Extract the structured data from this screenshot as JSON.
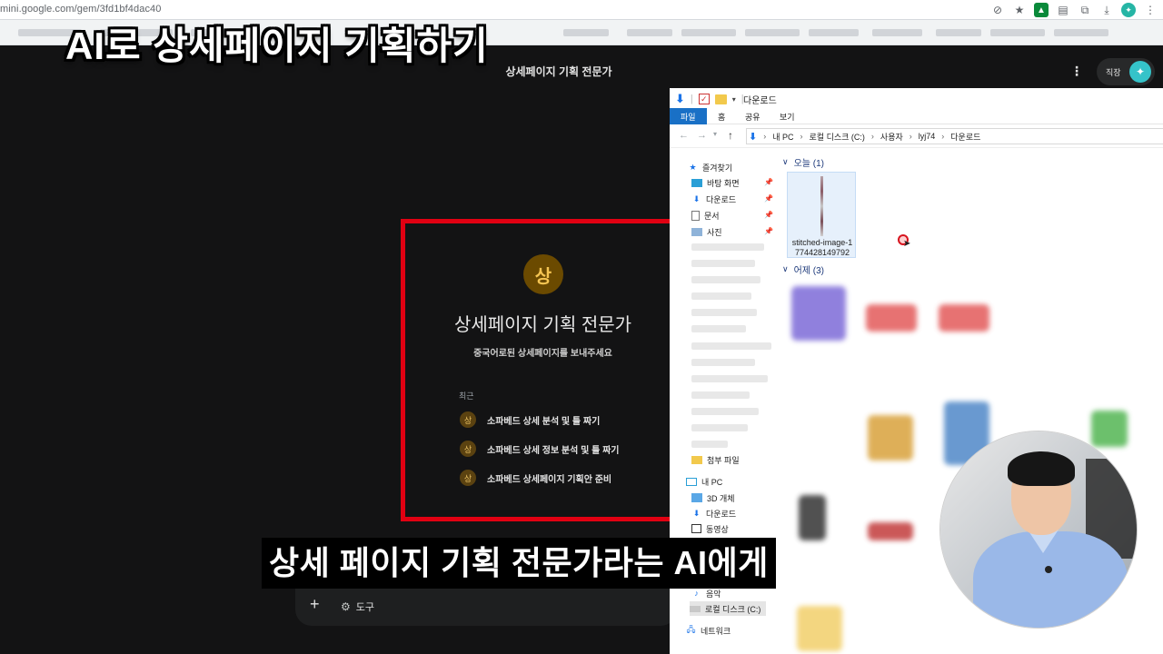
{
  "browser": {
    "url": "mini.google.com/gem/3fd1bf4dac40",
    "extension_icons": [
      "eye-off-icon",
      "star-icon",
      "extension-green-icon",
      "puzzle-icon",
      "download-icon",
      "profile-teal-icon"
    ]
  },
  "overlay": {
    "headline": "AI로 상세페이지 기획하기",
    "subtitle": "상세 페이지 기획 전문가라는 AI에게"
  },
  "gemini": {
    "page_title": "상세페이지 기획 전문가",
    "more_label": "⋮",
    "profile_label": "직장",
    "gem_avatar_letter": "상",
    "gem_name": "상세페이지 기획 전문가",
    "gem_description": "중국어로된 상세페이지를 보내주세요",
    "recent_label": "최근",
    "recent_items": [
      {
        "icon": "상",
        "label": "소파베드 상세 분석 및 틀 짜기"
      },
      {
        "icon": "상",
        "label": "소파베드 상세 정보 분석 및 틀 짜기"
      },
      {
        "icon": "상",
        "label": "소파베드 상세페이지 기획안 준비"
      }
    ],
    "input": {
      "plus": "+",
      "tools_label": "도구"
    },
    "accent_color": "#e10012"
  },
  "explorer": {
    "title": "다운로드",
    "ribbon_tabs": [
      "파일",
      "홈",
      "공유",
      "보기"
    ],
    "breadcrumb": [
      "내 PC",
      "로컬 디스크 (C:)",
      "사용자",
      "lyj74",
      "다운로드"
    ],
    "sidebar": {
      "quick_access": "즐겨찾기",
      "items": [
        "바탕 화면",
        "다운로드",
        "문서",
        "사진"
      ],
      "attach": "첨부 파일",
      "this_pc": "내 PC",
      "pc_items": [
        "3D 개체",
        "다운로드",
        "동영상"
      ],
      "music": "음악",
      "local_disk": "로컬 디스크 (C:)",
      "network": "네트워크"
    },
    "groups": {
      "today": "오늘 (1)",
      "yesterday": "어제 (3)"
    },
    "file": {
      "name_line1": "stitched-image-1",
      "name_line2": "774428149792"
    }
  }
}
